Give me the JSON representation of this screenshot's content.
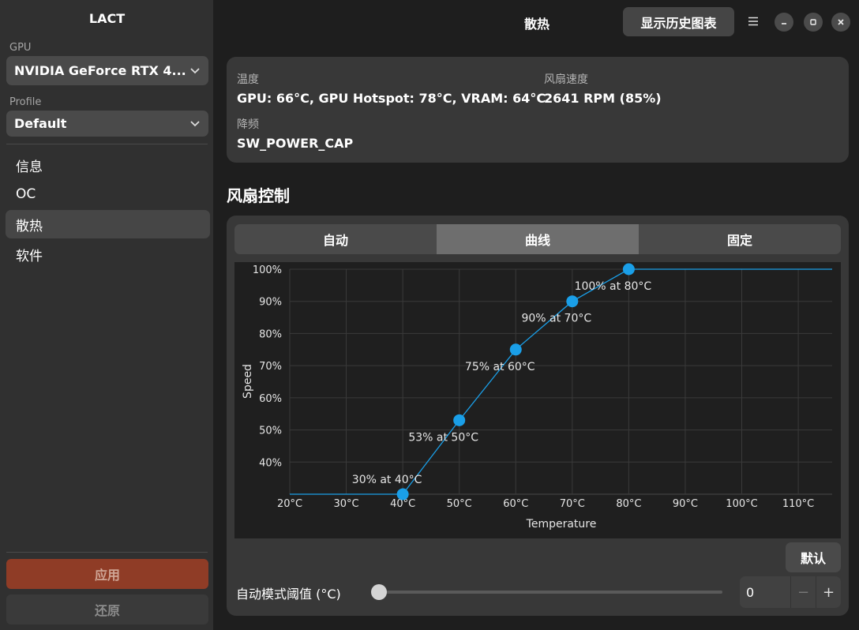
{
  "app": {
    "title": "LACT",
    "header_title": "散热",
    "history_button": "显示历史图表"
  },
  "sidebar": {
    "gpu_label": "GPU",
    "gpu_value": "NVIDIA GeForce RTX 4...",
    "profile_label": "Profile",
    "profile_value": "Default",
    "items": [
      {
        "label": "信息",
        "active": false
      },
      {
        "label": "OC",
        "active": false
      },
      {
        "label": "散热",
        "active": true
      },
      {
        "label": "软件",
        "active": false
      }
    ],
    "apply_label": "应用",
    "reset_label": "还原"
  },
  "info": {
    "temp_label": "温度",
    "temp_value": "GPU: 66°C, GPU Hotspot: 78°C, VRAM: 64°C",
    "fan_label": "风扇速度",
    "fan_value": "2641 RPM (85%)",
    "throttle_label": "降频",
    "throttle_value": "SW_POWER_CAP"
  },
  "fan_control": {
    "title": "风扇控制",
    "tabs": [
      {
        "label": "自动",
        "active": false
      },
      {
        "label": "曲线",
        "active": true
      },
      {
        "label": "固定",
        "active": false
      }
    ],
    "default_button": "默认",
    "threshold_label": "自动模式阈值 (°C)",
    "threshold_value": "0",
    "threshold_fraction": 0,
    "minus": "−",
    "plus": "+"
  },
  "chart_data": {
    "type": "line",
    "xlabel": "Temperature",
    "ylabel": "Speed",
    "xlim": [
      20,
      116
    ],
    "ylim": [
      30,
      100
    ],
    "x_ticks": [
      "20°C",
      "30°C",
      "40°C",
      "50°C",
      "60°C",
      "70°C",
      "80°C",
      "90°C",
      "100°C",
      "110°C"
    ],
    "x_tick_values": [
      20,
      30,
      40,
      50,
      60,
      70,
      80,
      90,
      100,
      110
    ],
    "y_ticks": [
      "100%",
      "90%",
      "80%",
      "70%",
      "60%",
      "50%",
      "40%"
    ],
    "y_tick_values": [
      100,
      90,
      80,
      70,
      60,
      50,
      40
    ],
    "points": [
      {
        "x": 40,
        "y": 30,
        "label": "30% at 40°C"
      },
      {
        "x": 50,
        "y": 53,
        "label": "53% at 50°C"
      },
      {
        "x": 60,
        "y": 75,
        "label": "75% at 60°C"
      },
      {
        "x": 70,
        "y": 90,
        "label": "90% at 70°C"
      },
      {
        "x": 80,
        "y": 100,
        "label": "100% at 80°C"
      }
    ],
    "grid": true,
    "color": "#1a9fe8"
  }
}
